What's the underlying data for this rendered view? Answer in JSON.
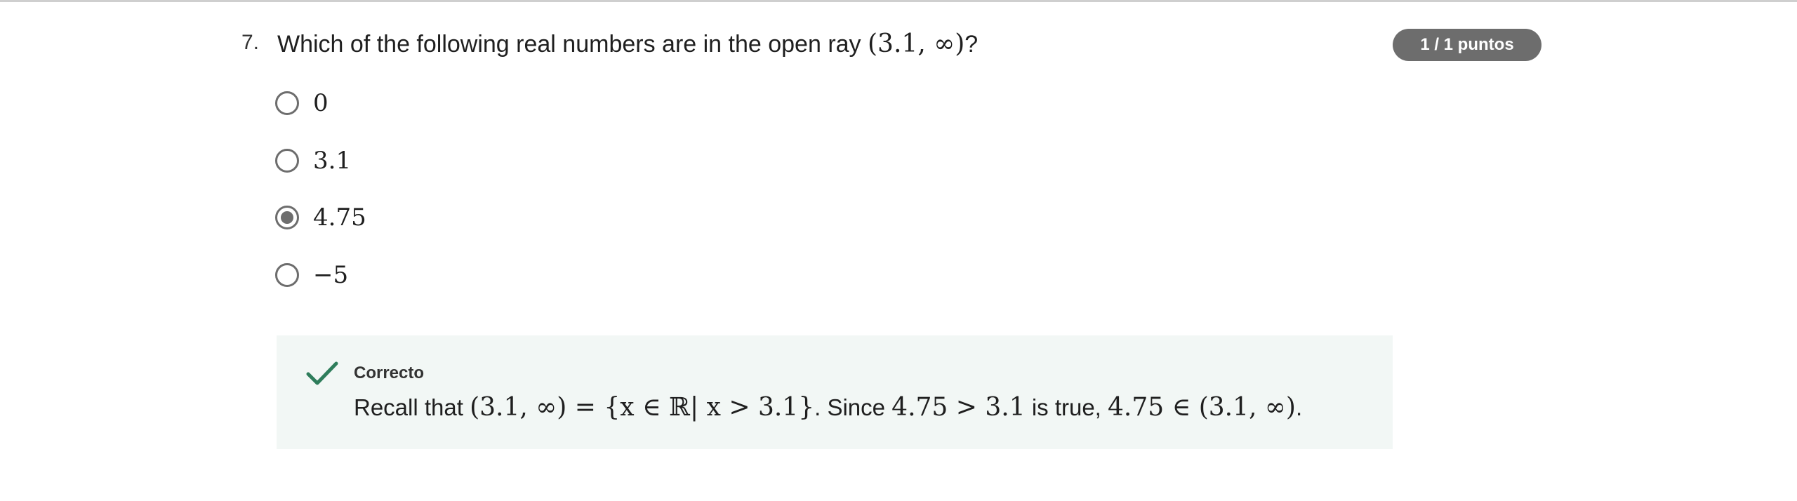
{
  "question": {
    "number": "7.",
    "text_before": "Which of the following real numbers are in the open ray",
    "math": "(3.1, ∞)",
    "text_after": "?"
  },
  "score_badge": "1 / 1 puntos",
  "options": [
    {
      "label": "0",
      "selected": false
    },
    {
      "label": "3.1",
      "selected": false
    },
    {
      "label": "4.75",
      "selected": true
    },
    {
      "label": "−5",
      "selected": false
    }
  ],
  "feedback": {
    "status": "Correcto",
    "text_recall": "Recall that",
    "math_1": "(3.1, ∞) = {x ∈ ℝ| x > 3.1}",
    "text_since": ". Since",
    "math_2": "4.75 > 3.1",
    "text_true": "is true,",
    "math_3": "4.75 ∈ (3.1, ∞)",
    "text_end": "."
  },
  "colors": {
    "accent_correct": "#2e7d5b",
    "badge_bg": "#6d6d6d",
    "feedback_bg": "#f2f7f5"
  }
}
